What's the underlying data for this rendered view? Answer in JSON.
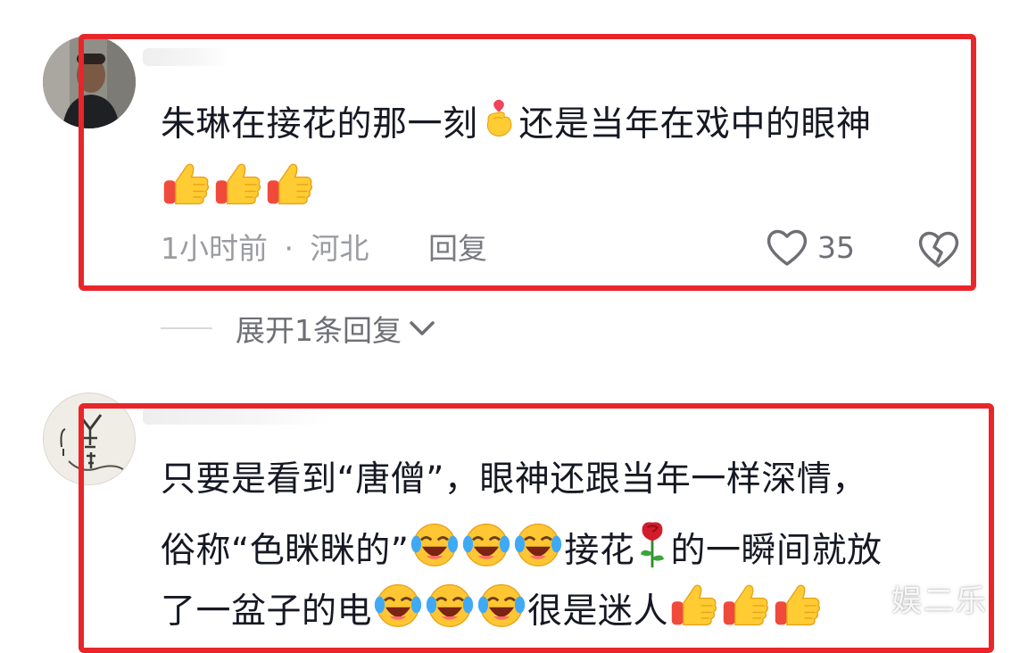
{
  "comments": [
    {
      "text_line1": "朱琳在接花的那一刻",
      "text_line1_after": "还是当年在戏中的眼神",
      "time": "1小时前",
      "separator": "·",
      "location": "河北",
      "reply_label": "回复",
      "likes": "35",
      "expand_label": "展开1条回复"
    },
    {
      "line1": "只要是看到“唐僧”，眼神还跟当年一样深情，",
      "line2_a": "俗称“色眯眯的”",
      "line2_b": "接花",
      "line2_c": "的一瞬间就放",
      "line3_a": "了一盆子的电",
      "line3_b": "很是迷人"
    }
  ],
  "watermark": "娱二乐",
  "colors": {
    "highlight": "#e8262a",
    "text": "#161823",
    "meta": "#9b9ca1"
  },
  "icons": {
    "heart_hand": "finger-heart-icon",
    "thumbs": "thumbs-up-icon",
    "laugh": "laughing-crying-icon",
    "rose": "rose-icon",
    "like": "heart-outline-icon",
    "dislike": "broken-heart-icon",
    "chevron": "chevron-down-icon"
  }
}
